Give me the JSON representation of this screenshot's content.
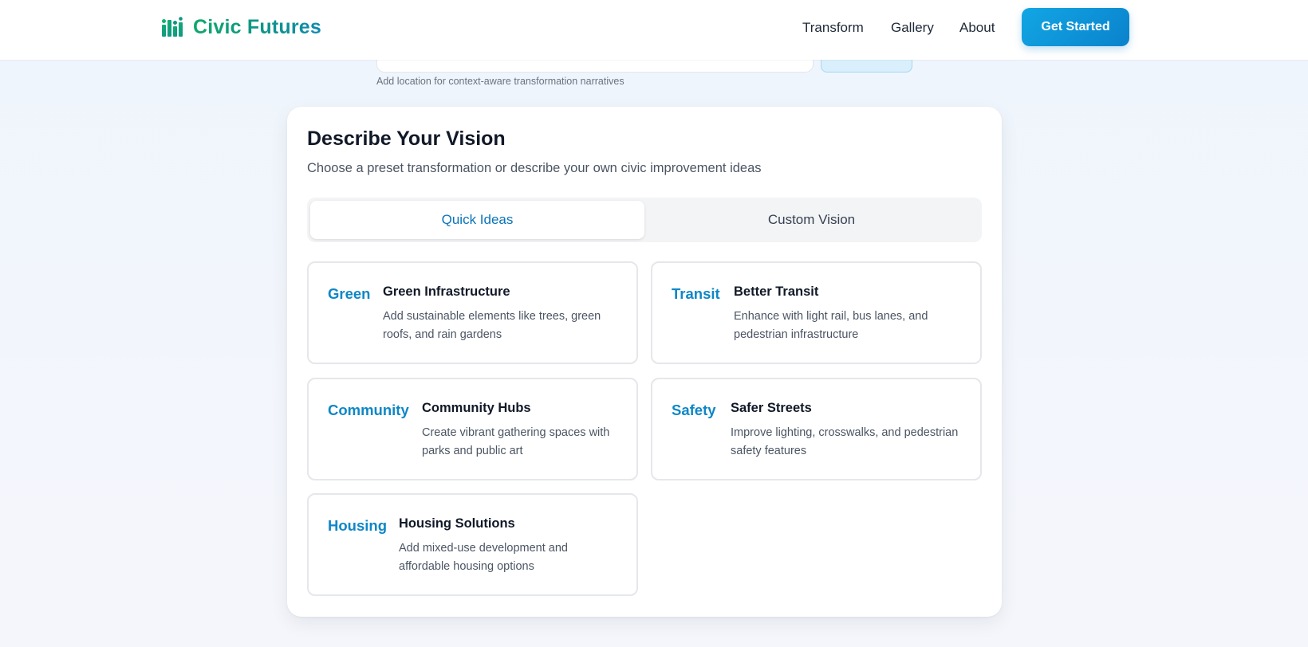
{
  "header": {
    "brand_name": "Civic Futures",
    "brand_icon": "bar-chart-icon",
    "nav": [
      {
        "label": "Transform"
      },
      {
        "label": "Gallery"
      },
      {
        "label": "About"
      }
    ],
    "cta_label": "Get Started"
  },
  "location": {
    "hint": "Add location for context-aware transformation narratives"
  },
  "vision": {
    "title": "Describe Your Vision",
    "subtitle": "Choose a preset transformation or describe your own civic improvement ideas",
    "tabs": [
      {
        "label": "Quick Ideas",
        "active": true
      },
      {
        "label": "Custom Vision",
        "active": false
      }
    ],
    "ideas": [
      {
        "tag": "Green",
        "title": "Green Infrastructure",
        "description": "Add sustainable elements like trees, green roofs, and rain gardens"
      },
      {
        "tag": "Transit",
        "title": "Better Transit",
        "description": "Enhance with light rail, bus lanes, and pedestrian infrastructure"
      },
      {
        "tag": "Community",
        "title": "Community Hubs",
        "description": "Create vibrant gathering spaces with parks and public art"
      },
      {
        "tag": "Safety",
        "title": "Safer Streets",
        "description": "Improve lighting, crosswalks, and pedestrian safety features"
      },
      {
        "tag": "Housing",
        "title": "Housing Solutions",
        "description": "Add mixed-use development and affordable housing options"
      }
    ]
  },
  "colors": {
    "accent": "#0e87c6",
    "brand_green": "#10a86a",
    "cta": "#0a82cc"
  }
}
